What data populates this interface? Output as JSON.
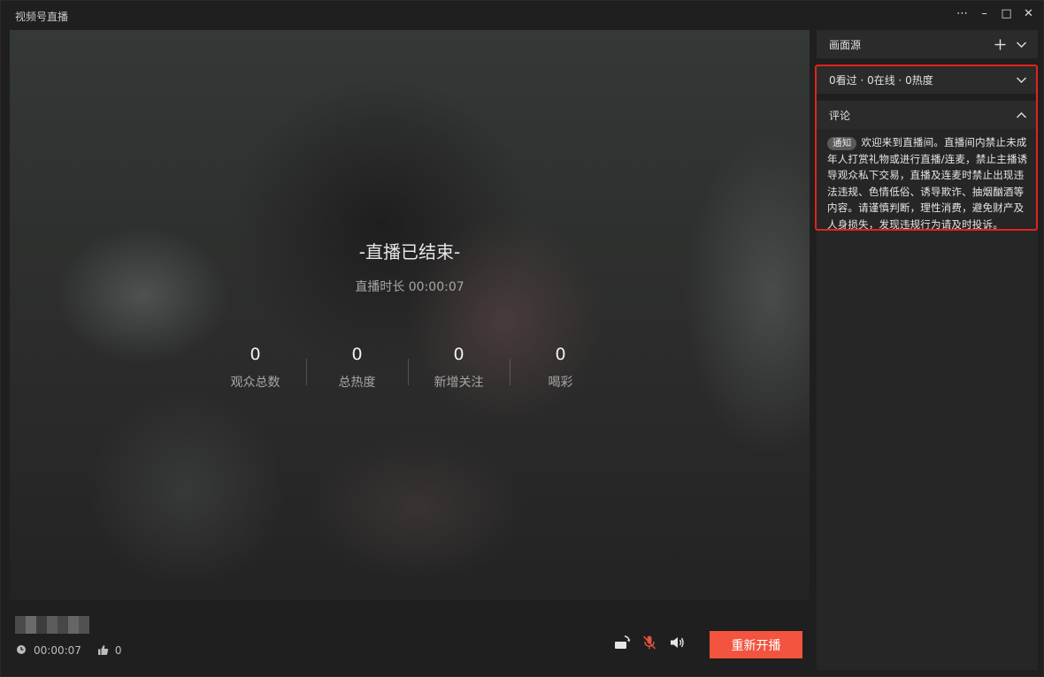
{
  "window": {
    "title": "视频号直播",
    "controls": {
      "more": "⋯",
      "minimize": "–",
      "maximize": "□",
      "close": "✕"
    }
  },
  "preview": {
    "ended_title": "-直播已结束-",
    "duration_label": "直播时长 00:00:07",
    "stats": [
      {
        "value": "0",
        "label": "观众总数"
      },
      {
        "value": "0",
        "label": "总热度"
      },
      {
        "value": "0",
        "label": "新增关注"
      },
      {
        "value": "0",
        "label": "喝彩"
      }
    ]
  },
  "footer": {
    "elapsed": "00:00:07",
    "likes": "0",
    "restart_label": "重新开播",
    "mic_muted_color": "#e2523f",
    "accent": "#f2543f"
  },
  "sidebar": {
    "sources_title": "画面源",
    "viewer_stats": "0看过 · 0在线 · 0热度",
    "comments_title": "评论",
    "notice_tag": "通知",
    "notice_text": "欢迎来到直播间。直播间内禁止未成年人打赏礼物或进行直播/连麦，禁止主播诱导观众私下交易，直播及连麦时禁止出现违法违规、色情低俗、诱导欺诈、抽烟酗酒等内容。请谨慎判断，理性消费，避免财产及人身损失，发现违规行为请及时投诉。",
    "highlight_color": "#e0241e"
  }
}
